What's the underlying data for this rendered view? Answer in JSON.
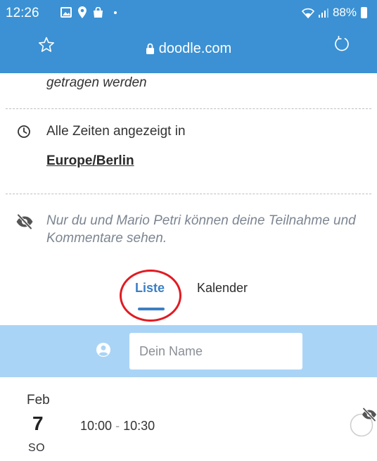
{
  "status_bar": {
    "time": "12:26",
    "battery": "88%"
  },
  "browser": {
    "url": "doodle.com"
  },
  "content": {
    "truncated_line": "getragen werden",
    "timezone_label": "Alle Zeiten angezeigt in",
    "timezone_link": "Europe/Berlin",
    "privacy_note": "Nur du und Mario Petri können deine Teilnahme und Kommentare sehen."
  },
  "tabs": [
    {
      "label": "Liste",
      "active": true
    },
    {
      "label": "Kalender",
      "active": false
    }
  ],
  "name_input": {
    "placeholder": "Dein Name",
    "value": ""
  },
  "option": {
    "month": "Feb",
    "day": "7",
    "weekday": "SO",
    "start": "10:00",
    "separator": "-",
    "end": "10:30"
  },
  "colors": {
    "brand_bar": "#3b91d3",
    "active_tab": "#3b7fc4",
    "name_band": "#a9d4f6",
    "highlight_annotation": "#e11b22"
  },
  "icons": [
    "star-icon",
    "lock-icon",
    "reload-icon",
    "clock-icon",
    "eye-slash-icon",
    "user-icon",
    "circle-check-icon"
  ]
}
